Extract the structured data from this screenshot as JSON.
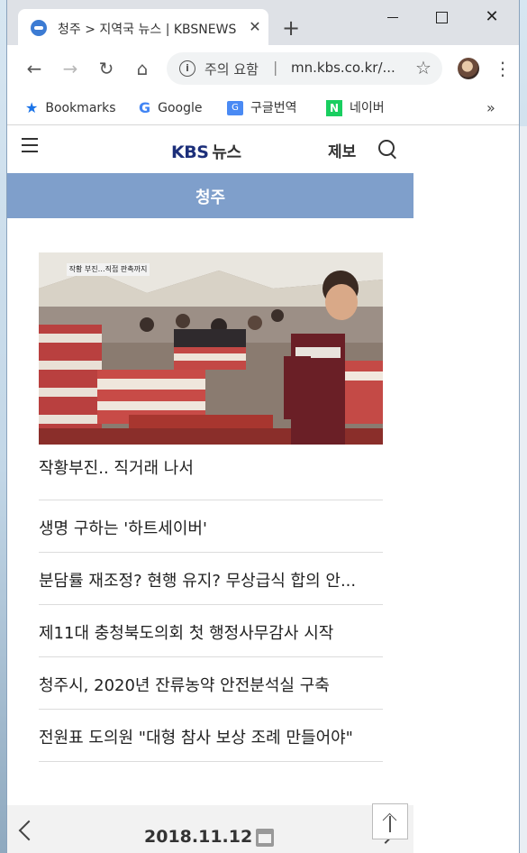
{
  "browser": {
    "tab_title": "청주 > 지역국 뉴스 | KBSNEWS",
    "tab_close": "✕",
    "new_tab": "+",
    "window_minimize": "",
    "window_close": "✕",
    "security_label": "주의 요함",
    "url": "mn.kbs.co.kr/...",
    "bookmarks": [
      {
        "label": "Bookmarks",
        "icon": "star-icon"
      },
      {
        "label": "Google",
        "icon": "google-icon"
      },
      {
        "label": "구글번역",
        "icon": "google-translate-icon"
      },
      {
        "label": "네이버",
        "icon": "naver-icon"
      }
    ],
    "bookmarks_more": "»"
  },
  "site": {
    "logo_text": "KBS",
    "logo_suffix": "뉴스",
    "report_label": "제보",
    "region": "청주",
    "photo_caption": "작황 부진…직접 판촉까지"
  },
  "news": {
    "featured_title": "작황부진.. 직거래 나서",
    "items": [
      "생명 구하는 '하트세이버'",
      "분담률 재조정? 현행 유지? 무상급식 합의 안...",
      "제11대 충청북도의회 첫 행정사무감사 시작",
      "청주시, 2020년 잔류농약 안전분석실 구축",
      "전원표 도의원 \"대형 참사 보상 조례 만들어야\""
    ]
  },
  "date_nav": {
    "date": "2018.11.12"
  },
  "colors": {
    "region_bar": "#7f9fcb",
    "logo": "#1c2f7a",
    "chrome_tabstrip": "#dee1e6"
  }
}
